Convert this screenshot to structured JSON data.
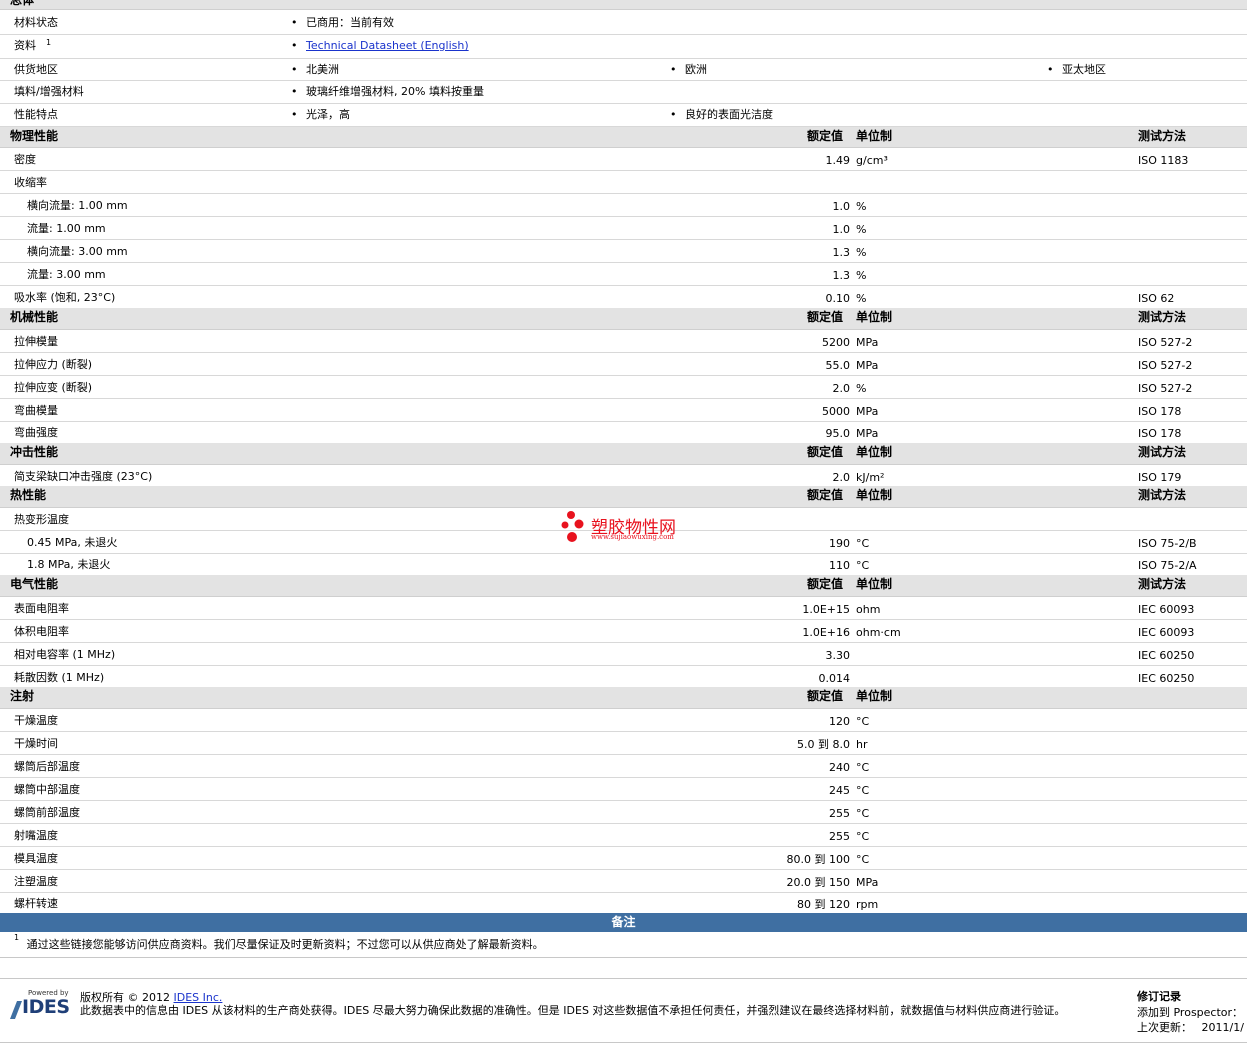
{
  "general": {
    "title": "总体",
    "rows": [
      {
        "label": "材料状态",
        "items": [
          "已商用：当前有效"
        ]
      },
      {
        "label": "资料",
        "sup": "1",
        "link": "Technical Datasheet (English)"
      },
      {
        "label": "供货地区",
        "items": [
          "北美洲",
          "欧洲",
          "亚太地区"
        ]
      },
      {
        "label": "填料/增强材料",
        "items": [
          "玻璃纤维增强材料, 20% 填料按重量"
        ]
      },
      {
        "label": "性能特点",
        "items": [
          "光泽，高",
          "良好的表面光洁度"
        ]
      }
    ]
  },
  "headers": {
    "nominal": "额定值",
    "unit": "单位制",
    "method": "测试方法"
  },
  "sections": [
    {
      "title": "物理性能",
      "show_method": true,
      "rows": [
        {
          "label": "密度",
          "value": "1.49",
          "unit": "g/cm³",
          "method": "ISO 1183"
        },
        {
          "label": "收缩率",
          "value": "",
          "unit": "",
          "method": ""
        },
        {
          "label": "横向流量: 1.00 mm",
          "indent": true,
          "value": "1.0",
          "unit": "%",
          "method": ""
        },
        {
          "label": "流量: 1.00 mm",
          "indent": true,
          "value": "1.0",
          "unit": "%",
          "method": ""
        },
        {
          "label": "横向流量: 3.00 mm",
          "indent": true,
          "value": "1.3",
          "unit": "%",
          "method": ""
        },
        {
          "label": "流量: 3.00 mm",
          "indent": true,
          "value": "1.3",
          "unit": "%",
          "method": ""
        },
        {
          "label": "吸水率 (饱和, 23°C)",
          "value": "0.10",
          "unit": "%",
          "method": "ISO 62"
        }
      ]
    },
    {
      "title": "机械性能",
      "show_method": true,
      "rows": [
        {
          "label": "拉伸模量",
          "value": "5200",
          "unit": "MPa",
          "method": "ISO 527-2"
        },
        {
          "label": "拉伸应力 (断裂)",
          "value": "55.0",
          "unit": "MPa",
          "method": "ISO 527-2"
        },
        {
          "label": "拉伸应变 (断裂)",
          "value": "2.0",
          "unit": "%",
          "method": "ISO 527-2"
        },
        {
          "label": "弯曲模量",
          "value": "5000",
          "unit": "MPa",
          "method": "ISO 178"
        },
        {
          "label": "弯曲强度",
          "value": "95.0",
          "unit": "MPa",
          "method": "ISO 178"
        }
      ]
    },
    {
      "title": "冲击性能",
      "show_method": true,
      "rows": [
        {
          "label": "简支梁缺口冲击强度 (23°C)",
          "value": "2.0",
          "unit": "kJ/m²",
          "method": "ISO 179"
        }
      ]
    },
    {
      "title": "热性能",
      "show_method": true,
      "rows": [
        {
          "label": "热变形温度",
          "value": "",
          "unit": "",
          "method": ""
        },
        {
          "label": "0.45 MPa, 未退火",
          "indent": true,
          "value": "190",
          "unit": "°C",
          "method": "ISO 75-2/B"
        },
        {
          "label": "1.8 MPa, 未退火",
          "indent": true,
          "value": "110",
          "unit": "°C",
          "method": "ISO 75-2/A"
        }
      ]
    },
    {
      "title": "电气性能",
      "show_method": true,
      "rows": [
        {
          "label": "表面电阻率",
          "value": "1.0E+15",
          "unit": "ohm",
          "method": "IEC 60093"
        },
        {
          "label": "体积电阻率",
          "value": "1.0E+16",
          "unit": "ohm·cm",
          "method": "IEC 60093"
        },
        {
          "label": "相对电容率 (1 MHz)",
          "value": "3.30",
          "unit": "",
          "method": "IEC 60250"
        },
        {
          "label": "耗散因数 (1 MHz)",
          "value": "0.014",
          "unit": "",
          "method": "IEC 60250"
        }
      ]
    },
    {
      "title": "注射",
      "show_method": false,
      "rows": [
        {
          "label": "干燥温度",
          "value": "120",
          "unit": "°C",
          "method": ""
        },
        {
          "label": "干燥时间",
          "value": "5.0 到  8.0",
          "unit": "hr",
          "method": ""
        },
        {
          "label": "螺筒后部温度",
          "value": "240",
          "unit": "°C",
          "method": ""
        },
        {
          "label": "螺筒中部温度",
          "value": "245",
          "unit": "°C",
          "method": ""
        },
        {
          "label": "螺筒前部温度",
          "value": "255",
          "unit": "°C",
          "method": ""
        },
        {
          "label": "射嘴温度",
          "value": "255",
          "unit": "°C",
          "method": ""
        },
        {
          "label": "模具温度",
          "value": "80.0 到  100",
          "unit": "°C",
          "method": ""
        },
        {
          "label": "注塑温度",
          "value": "20.0 到  150",
          "unit": "MPa",
          "method": ""
        },
        {
          "label": "螺杆转速",
          "value": "80 到  120",
          "unit": "rpm",
          "method": ""
        }
      ]
    }
  ],
  "notes": {
    "title": "备注",
    "footnote_num": "1",
    "footnote": "通过这些链接您能够访问供应商资料。我们尽量保证及时更新资料；不过您可以从供应商处了解最新资料。"
  },
  "watermark": {
    "name": "塑胶物性网",
    "url": "www.sujiaowuxing.com"
  },
  "footer": {
    "logo_small": "Powered by",
    "logo_text": "IDES",
    "copyright_prefix": "版权所有 © 2012",
    "copyright_link": "IDES Inc.",
    "disclaimer": "此数据表中的信息由 IDES 从该材料的生产商处获得。IDES 尽最大努力确保此数据的准确性。但是 IDES 对这些数据值不承担任何责任，并强烈建议在最终选择材料前，就数据值与材料供应商进行验证。",
    "rev_title": "修订记录",
    "rev_added": "添加到 Prospector：",
    "rev_updated": "上次更新：",
    "rev_date": "2011/1/"
  },
  "colors": {
    "section_bg": "#e3e3e3",
    "notes_bar": "#3f6fa2",
    "link": "#1a33cc",
    "watermark": "#e8121e"
  }
}
